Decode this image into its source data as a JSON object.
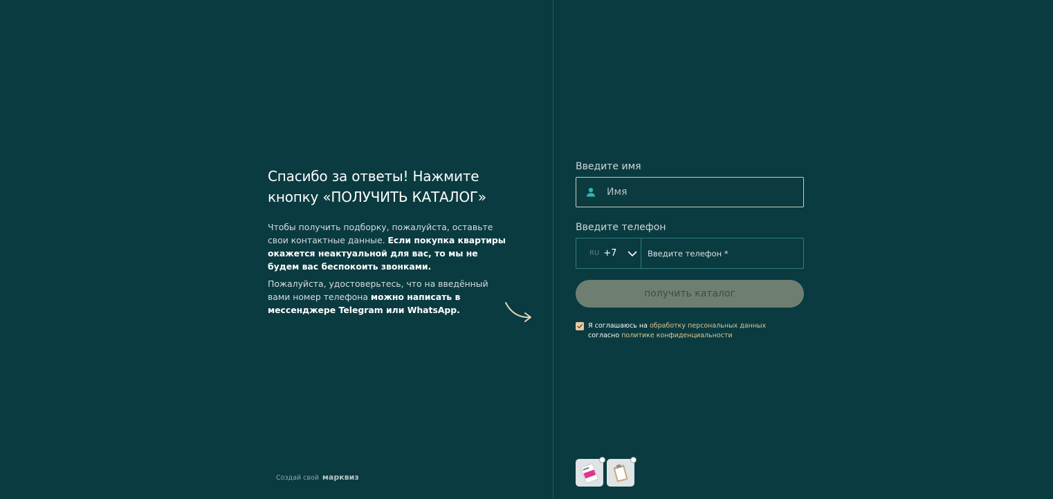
{
  "left": {
    "heading": "Спасибо за ответы! Нажмите кнопку «ПОЛУЧИТЬ КАТАЛОГ»",
    "para1_plain": "Чтобы получить подборку, пожалуйста, оставьте свои контактные данные. ",
    "para1_bold": "Если покупка квартиры окажется неактуальной для вас, то мы не будем вас беспокоить звонками.",
    "para2_plain": "Пожалуйста, удостоверьтесь, что на введённый вами номер телефона ",
    "para2_bold": "можно написать в мессенджере Telegram или WhatsApp."
  },
  "footer": {
    "credit_text": "Создай свой",
    "credit_brand": "марквиз"
  },
  "form": {
    "name_label": "Введите имя",
    "name_placeholder": "Имя",
    "name_icon": "user-icon",
    "phone_label": "Введите телефон",
    "country_code": "RU",
    "dial_code": "+7",
    "phone_placeholder": "Введите телефон *",
    "submit_label": "получить каталог",
    "consent_checked": true,
    "consent_prefix": "Я соглашаюсь на ",
    "consent_link1": "обработку персональных данных",
    "consent_middle": " согласно ",
    "consent_link2": "политике конфиденциальности"
  },
  "colors": {
    "background": "#0a3b40",
    "accent": "#2fb5b5",
    "link": "#e1c68e",
    "button": "#6e7f72"
  }
}
